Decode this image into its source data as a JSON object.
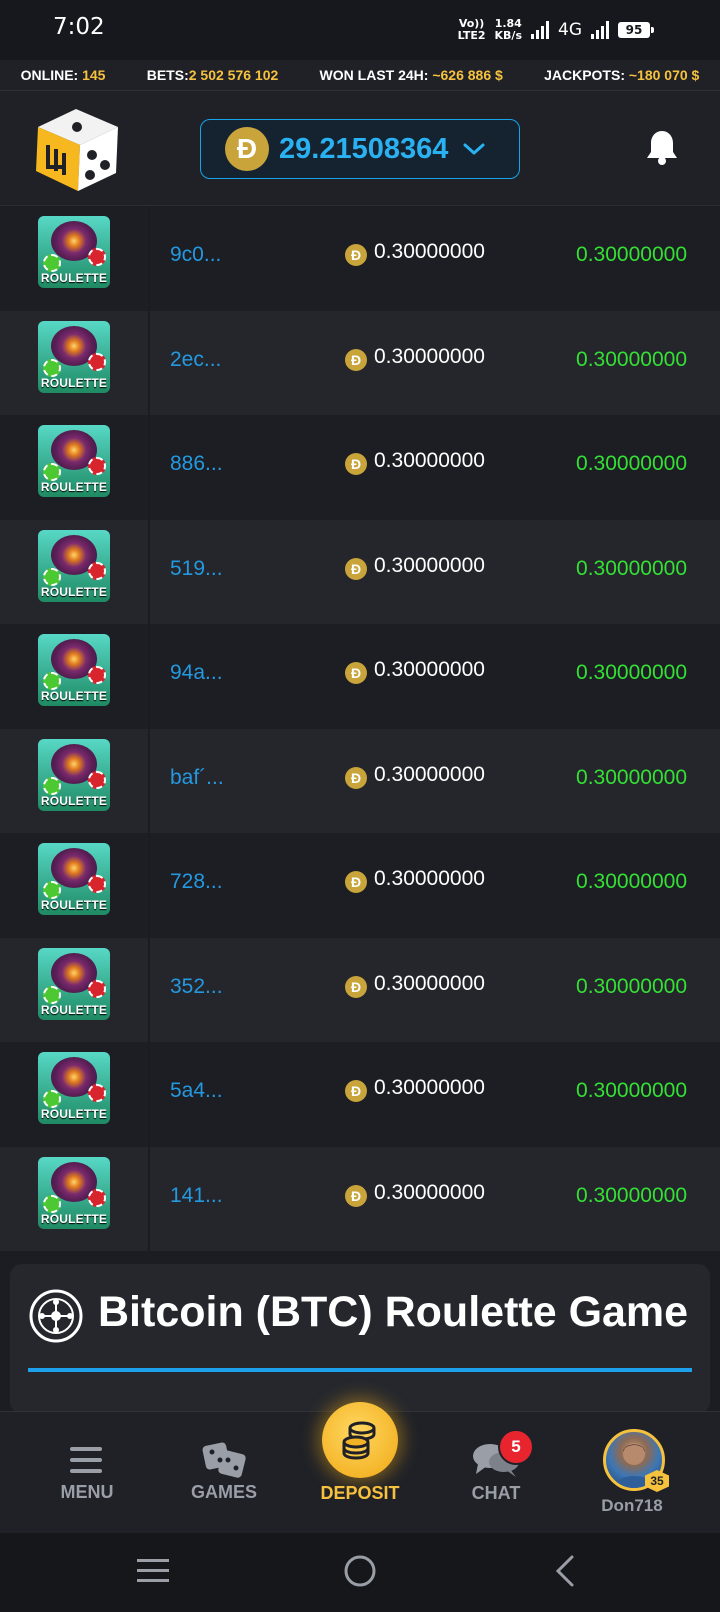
{
  "status_bar": {
    "time": "7:02",
    "volte": "Vo))",
    "lte": "LTE2",
    "speed_value": "1.84",
    "speed_unit": "KB/s",
    "network": "4G",
    "battery": "95"
  },
  "stats": {
    "online_label": "ONLINE:",
    "online_value": "145",
    "bets_label": "BETS:",
    "bets_value": "2 502 576 102",
    "won_label": "WON LAST 24H:",
    "won_value": "~626 886 $",
    "jackpots_label": "JACKPOTS:",
    "jackpots_value": "~180 070 $"
  },
  "header": {
    "coin_symbol": "Ð",
    "balance": "29.21508364",
    "accent": "#2ab1f2"
  },
  "bets": [
    {
      "game": "ROULETTE",
      "hash": "9c0...",
      "coin": "Ð",
      "bet": "0.30000000",
      "payout": "0.30000000"
    },
    {
      "game": "ROULETTE",
      "hash": "2ec...",
      "coin": "Ð",
      "bet": "0.30000000",
      "payout": "0.30000000"
    },
    {
      "game": "ROULETTE",
      "hash": "886...",
      "coin": "Ð",
      "bet": "0.30000000",
      "payout": "0.30000000"
    },
    {
      "game": "ROULETTE",
      "hash": "519...",
      "coin": "Ð",
      "bet": "0.30000000",
      "payout": "0.30000000"
    },
    {
      "game": "ROULETTE",
      "hash": "94a...",
      "coin": "Ð",
      "bet": "0.30000000",
      "payout": "0.30000000"
    },
    {
      "game": "ROULETTE",
      "hash": "baf´...",
      "coin": "Ð",
      "bet": "0.30000000",
      "payout": "0.30000000"
    },
    {
      "game": "ROULETTE",
      "hash": "728...",
      "coin": "Ð",
      "bet": "0.30000000",
      "payout": "0.30000000"
    },
    {
      "game": "ROULETTE",
      "hash": "352...",
      "coin": "Ð",
      "bet": "0.30000000",
      "payout": "0.30000000"
    },
    {
      "game": "ROULETTE",
      "hash": "5a4...",
      "coin": "Ð",
      "bet": "0.30000000",
      "payout": "0.30000000"
    },
    {
      "game": "ROULETTE",
      "hash": "141...",
      "coin": "Ð",
      "bet": "0.30000000",
      "payout": "0.30000000"
    }
  ],
  "info": {
    "title": "Bitcoin (BTC) Roulette Game"
  },
  "nav": {
    "menu": "MENU",
    "games": "GAMES",
    "deposit": "DEPOSIT",
    "chat": "CHAT",
    "chat_badge": "5",
    "username": "Don718",
    "level": "35"
  },
  "colors": {
    "win": "#34e034",
    "hash": "#2499e0",
    "gold": "#f6c23e",
    "deposit": "#f6c23e"
  }
}
